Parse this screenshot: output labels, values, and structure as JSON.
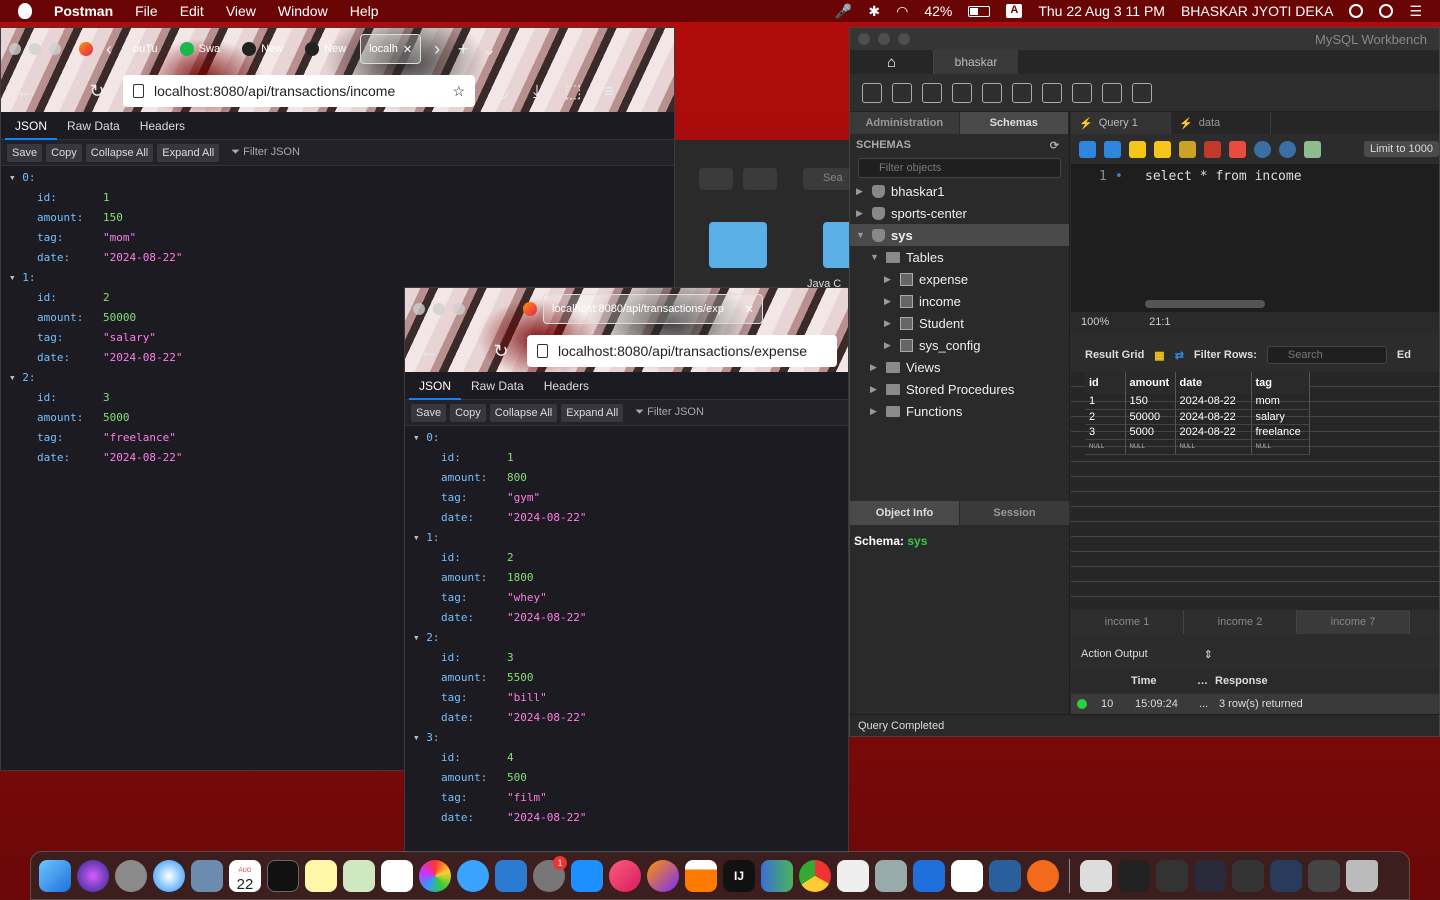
{
  "menubar": {
    "app": "Postman",
    "items": [
      "File",
      "Edit",
      "View",
      "Window",
      "Help"
    ],
    "battery": "42%",
    "input_source": "A",
    "clock": "Thu 22 Aug  3 11 PM",
    "user": "BHASKAR JYOTI DEKA"
  },
  "win1": {
    "tabs": [
      {
        "label": "ouTu"
      },
      {
        "label": "Swa"
      },
      {
        "label": "New"
      },
      {
        "label": "New"
      },
      {
        "label": "localh"
      }
    ],
    "url": "localhost:8080/api/transactions/income",
    "json_tabs": [
      "JSON",
      "Raw Data",
      "Headers"
    ],
    "toolbar": [
      "Save",
      "Copy",
      "Collapse All",
      "Expand All"
    ],
    "filter": "Filter JSON",
    "records": [
      {
        "idx": "0:",
        "id": "1",
        "amount": "150",
        "tag": "\"mom\"",
        "date": "\"2024-08-22\""
      },
      {
        "idx": "1:",
        "id": "2",
        "amount": "50000",
        "tag": "\"salary\"",
        "date": "\"2024-08-22\""
      },
      {
        "idx": "2:",
        "id": "3",
        "amount": "5000",
        "tag": "\"freelance\"",
        "date": "\"2024-08-22\""
      }
    ]
  },
  "win2": {
    "tab": "localhost:8080/api/transactions/exp",
    "url": "localhost:8080/api/transactions/expense",
    "json_tabs": [
      "JSON",
      "Raw Data",
      "Headers"
    ],
    "toolbar": [
      "Save",
      "Copy",
      "Collapse All",
      "Expand All"
    ],
    "filter": "Filter JSON",
    "records": [
      {
        "idx": "0:",
        "id": "1",
        "amount": "800",
        "tag": "\"gym\"",
        "date": "\"2024-08-22\""
      },
      {
        "idx": "1:",
        "id": "2",
        "amount": "1800",
        "tag": "\"whey\"",
        "date": "\"2024-08-22\""
      },
      {
        "idx": "2:",
        "id": "3",
        "amount": "5500",
        "tag": "\"bill\"",
        "date": "\"2024-08-22\""
      },
      {
        "idx": "3:",
        "id": "4",
        "amount": "500",
        "tag": "\"film\"",
        "date": "\"2024-08-22\""
      }
    ]
  },
  "keys": {
    "id": "id:",
    "amount": "amount:",
    "tag": "tag:",
    "date": "date:"
  },
  "finder": {
    "search": "Sea",
    "folder_label": "Java C"
  },
  "workbench": {
    "title": "MySQL Workbench",
    "conn_tab": "bhaskar",
    "panel_tabs": [
      "Administration",
      "Schemas"
    ],
    "schemas_header": "SCHEMAS",
    "filter_placeholder": "Filter objects",
    "tree": [
      {
        "label": "bhaskar1",
        "indent": 0,
        "kind": "db",
        "open": false
      },
      {
        "label": "sports-center",
        "indent": 0,
        "kind": "db",
        "open": false
      },
      {
        "label": "sys",
        "indent": 0,
        "kind": "db",
        "open": true,
        "selected": true
      },
      {
        "label": "Tables",
        "indent": 1,
        "kind": "folder",
        "open": true
      },
      {
        "label": "expense",
        "indent": 2,
        "kind": "table",
        "open": false
      },
      {
        "label": "income",
        "indent": 2,
        "kind": "table",
        "open": false
      },
      {
        "label": "Student",
        "indent": 2,
        "kind": "table",
        "open": false
      },
      {
        "label": "sys_config",
        "indent": 2,
        "kind": "table",
        "open": false
      },
      {
        "label": "Views",
        "indent": 1,
        "kind": "folder",
        "open": false
      },
      {
        "label": "Stored Procedures",
        "indent": 1,
        "kind": "folder",
        "open": false
      },
      {
        "label": "Functions",
        "indent": 1,
        "kind": "folder",
        "open": false
      }
    ],
    "info_tabs": [
      "Object Info",
      "Session"
    ],
    "schema_label": "Schema:",
    "schema_value": "sys",
    "query_tabs": [
      "Query 1",
      "data"
    ],
    "limit": "Limit to 1000",
    "editor": {
      "line": "1",
      "code": "select * from income"
    },
    "zoom": "100%",
    "cursor_pos": "21:1",
    "result": {
      "label": "Result Grid",
      "filter_label": "Filter Rows:",
      "search": "Search",
      "edit": "Ed"
    },
    "grid": {
      "columns": [
        "id",
        "amount",
        "date",
        "tag"
      ],
      "rows": [
        [
          "1",
          "150",
          "2024-08-22",
          "mom"
        ],
        [
          "2",
          "50000",
          "2024-08-22",
          "salary"
        ],
        [
          "3",
          "5000",
          "2024-08-22",
          "freelance"
        ]
      ],
      "null_row": [
        "NULL",
        "NULL",
        "NULL",
        "NULL"
      ]
    },
    "result_tabs": [
      "income 1",
      "income 2",
      "income 7"
    ],
    "action_output": "Action Output",
    "action_head": [
      "Time",
      "Response"
    ],
    "action_row": {
      "num": "10",
      "time": "15:09:24",
      "dots": "...",
      "response": "3 row(s) returned"
    },
    "status": "Query Completed"
  },
  "dock": {
    "calendar_day": "22",
    "calendar_month": "AUG",
    "badge": "1"
  }
}
